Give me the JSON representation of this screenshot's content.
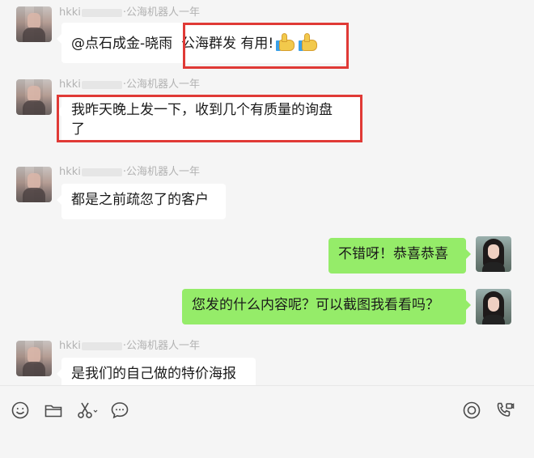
{
  "messages": [
    {
      "side": "left",
      "sender_prefix": "hkki",
      "sender_suffix": "·公海机器人一年",
      "text_before": "@点石成金-晓雨",
      "text_highlight": "公海群发 有用!",
      "emoji": [
        "thumbs-up",
        "thumbs-up"
      ]
    },
    {
      "side": "left",
      "sender_prefix": "hkki",
      "sender_suffix": "·公海机器人一年",
      "line1": "我昨天晚上发一下，收到几个有质量的询盘",
      "line2": "了"
    },
    {
      "side": "left",
      "sender_prefix": "hkki",
      "sender_suffix": "·公海机器人一年",
      "text": "都是之前疏忽了的客户"
    },
    {
      "side": "right",
      "text": "不错呀！恭喜恭喜"
    },
    {
      "side": "right",
      "text": "您发的什么内容呢？可以截图我看看吗？"
    },
    {
      "side": "left",
      "sender_prefix": "hkki",
      "sender_suffix": "·公海机器人一年",
      "text": "是我们的自己做的特价海报"
    }
  ],
  "toolbar": {
    "left_tools": [
      "emoji-icon",
      "folder-icon",
      "scissors-icon",
      "chat-bubble-icon"
    ],
    "right_tools": [
      "live-icon",
      "video-call-icon"
    ]
  },
  "colors": {
    "background": "#f5f5f5",
    "bubble_self": "#95ec69",
    "bubble_peer": "#ffffff",
    "highlight": "#e03a36",
    "sender_name": "#b2b2b2"
  }
}
